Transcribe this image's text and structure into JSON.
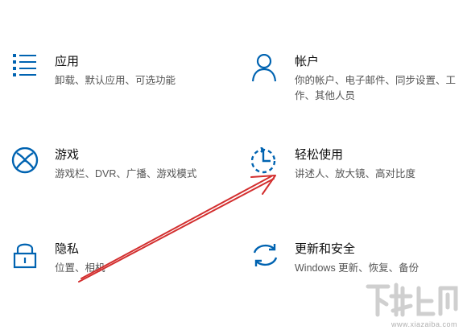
{
  "settings": {
    "apps": {
      "title": "应用",
      "desc": "卸载、默认应用、可选功能",
      "icon": "apps-list-icon"
    },
    "accounts": {
      "title": "帐户",
      "desc": "你的帐户、电子邮件、同步设置、工作、其他人员",
      "icon": "person-icon"
    },
    "gaming": {
      "title": "游戏",
      "desc": "游戏栏、DVR、广播、游戏模式",
      "icon": "xbox-icon"
    },
    "ease": {
      "title": "轻松使用",
      "desc": "讲述人、放大镜、高对比度",
      "icon": "ease-of-access-icon"
    },
    "privacy": {
      "title": "隐私",
      "desc": "位置、相机",
      "icon": "lock-icon"
    },
    "update": {
      "title": "更新和安全",
      "desc": "Windows 更新、恢复、备份",
      "icon": "sync-arrows-icon"
    }
  },
  "annotation": {
    "color": "#d32f2f",
    "icon": "red-arrow-annotation"
  },
  "watermark": {
    "site": "www.xiazaiba.com",
    "logo": "xiazaiba-logo"
  },
  "accent_color": "#0063b1"
}
